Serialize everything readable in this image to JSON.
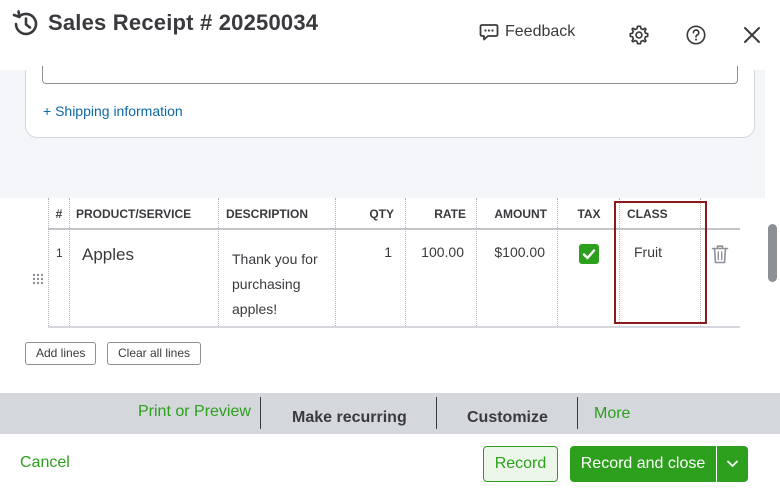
{
  "header": {
    "title": "Sales Receipt # 20250034",
    "feedback_label": "Feedback"
  },
  "form": {
    "shipping_link": "+ Shipping information"
  },
  "table": {
    "columns": [
      "#",
      "PRODUCT/SERVICE",
      "DESCRIPTION",
      "QTY",
      "RATE",
      "AMOUNT",
      "TAX",
      "CLASS"
    ],
    "rows": [
      {
        "index": "1",
        "product": "Apples",
        "description_lines": [
          "Thank you for",
          "purchasing",
          "apples!"
        ],
        "qty": "1",
        "rate": "100.00",
        "amount": "$100.00",
        "tax_checked": true,
        "class": "Fruit"
      }
    ],
    "add_lines_label": "Add lines",
    "clear_lines_label": "Clear all lines"
  },
  "action_bar": {
    "print_preview": "Print or Preview",
    "make_recurring": "Make recurring",
    "customize": "Customize",
    "more": "More"
  },
  "footer": {
    "cancel": "Cancel",
    "record": "Record",
    "record_and_close": "Record and close"
  },
  "colors": {
    "brand_green": "#2ca01c",
    "link_blue": "#0d68a8",
    "highlight_red": "#8b1a1a"
  }
}
